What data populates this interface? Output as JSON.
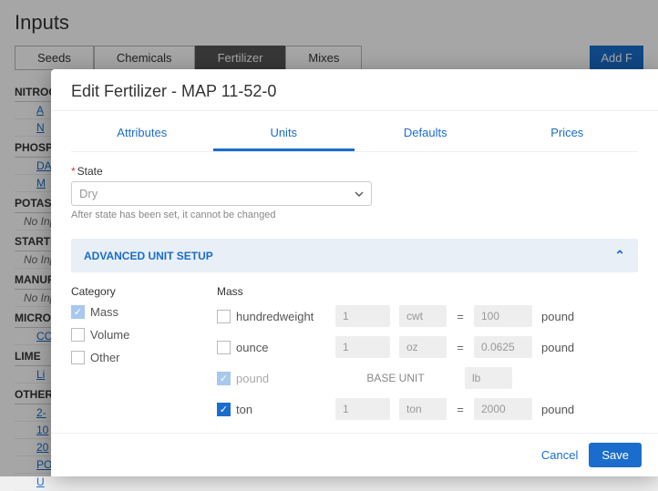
{
  "page": {
    "title": "Inputs",
    "tabs": [
      "Seeds",
      "Chemicals",
      "Fertilizer",
      "Mixes"
    ],
    "active_tab": "Fertilizer",
    "add_btn": "Add F"
  },
  "sections": {
    "nitrogen": {
      "head": "NITROGEN",
      "items": [
        "A",
        "N"
      ]
    },
    "phosphorus": {
      "head": "PHOSPHO",
      "items": [
        "DA",
        "M"
      ]
    },
    "potassium": {
      "head": "POTASSIU",
      "empty": "No Inputs"
    },
    "starter": {
      "head": "STARTER",
      "empty": "No Inputs"
    },
    "manure": {
      "head": "MANURE",
      "empty": "No Inputs"
    },
    "micro": {
      "head": "MICRONUT",
      "items": [
        "CO"
      ]
    },
    "lime": {
      "head": "LIME",
      "items": [
        "Li"
      ]
    },
    "other": {
      "head": "OTHER FE",
      "items": [
        "2-",
        "10",
        "20",
        "PO",
        "U"
      ]
    }
  },
  "modal": {
    "title": "Edit Fertilizer - MAP 11-52-0",
    "tabs": [
      "Attributes",
      "Units",
      "Defaults",
      "Prices"
    ],
    "active_tab": "Units",
    "state": {
      "label": "State",
      "value": "Dry",
      "hint": "After state has been set, it cannot be changed"
    },
    "advanced_label": "ADVANCED UNIT SETUP",
    "category": {
      "label": "Category",
      "options": [
        {
          "label": "Mass",
          "checked": true,
          "dim": true
        },
        {
          "label": "Volume",
          "checked": false
        },
        {
          "label": "Other",
          "checked": false
        }
      ]
    },
    "mass": {
      "label": "Mass",
      "rows": [
        {
          "name": "hundredweight",
          "checked": false,
          "qty": "1",
          "unit": "cwt",
          "value": "100",
          "result": "pound"
        },
        {
          "name": "ounce",
          "checked": false,
          "qty": "1",
          "unit": "oz",
          "value": "0.0625",
          "result": "pound"
        },
        {
          "name": "pound",
          "checked": true,
          "dim": true,
          "base": true,
          "base_label": "BASE UNIT",
          "unit": "lb"
        },
        {
          "name": "ton",
          "checked": true,
          "qty": "1",
          "unit": "ton",
          "value": "2000",
          "result": "pound"
        }
      ]
    },
    "footer": {
      "cancel": "Cancel",
      "save": "Save"
    }
  }
}
